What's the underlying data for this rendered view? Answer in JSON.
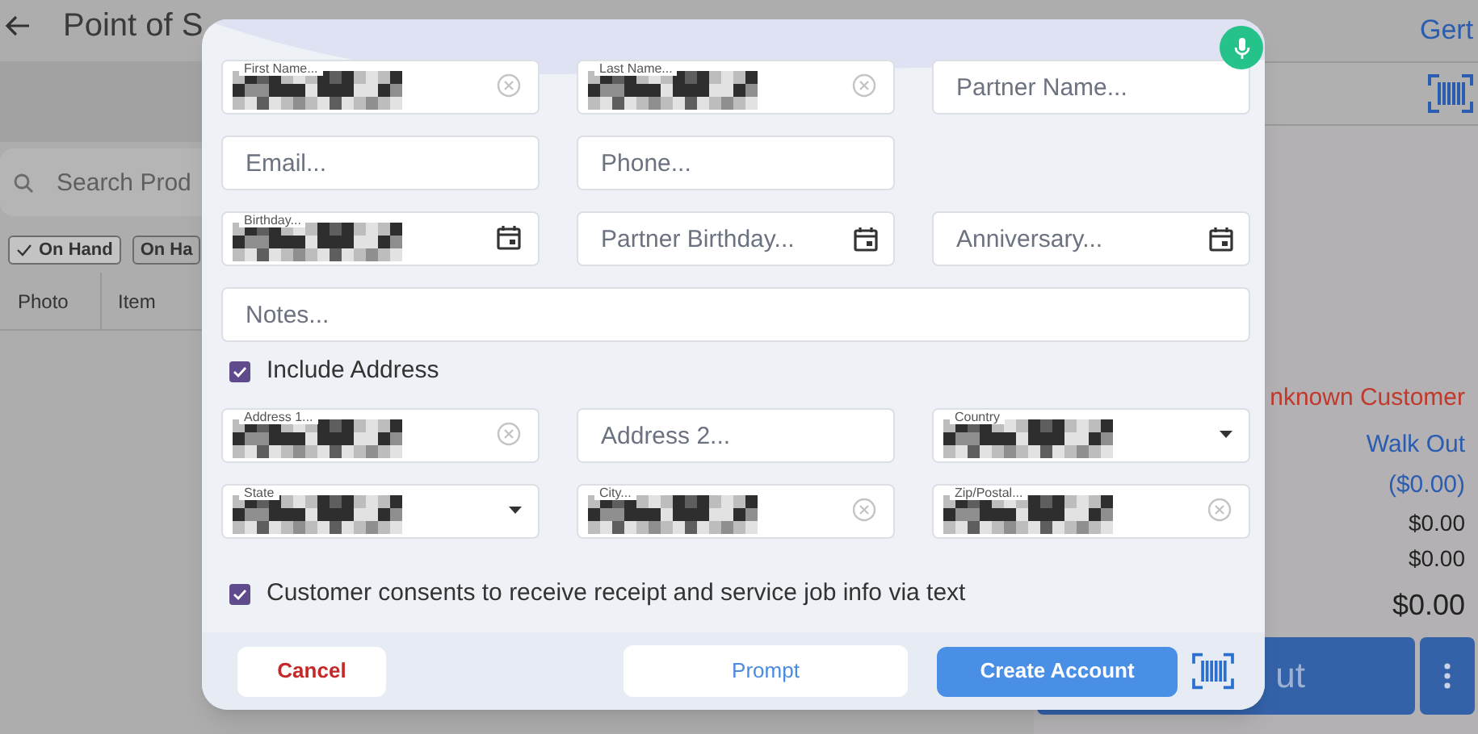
{
  "header": {
    "title": "Point of S",
    "user": "Gert"
  },
  "search": {
    "placeholder": "Search Prod"
  },
  "filters": [
    {
      "label": "On Hand",
      "selected": true
    },
    {
      "label": "On Ha",
      "selected": false
    }
  ],
  "table": {
    "columns": [
      "Photo",
      "Item"
    ]
  },
  "customer": {
    "name": "nknown Customer",
    "link": "Walk Out"
  },
  "totals": [
    {
      "kind": "credit",
      "text": "($0.00)"
    },
    {
      "kind": "line",
      "text": "$0.00"
    },
    {
      "kind": "line",
      "text": "$0.00"
    },
    {
      "kind": "total",
      "text": "$0.00"
    }
  ],
  "checkout": {
    "label": "ut"
  },
  "dialog": {
    "fields": [
      {
        "label": "First Name...",
        "kind": "text",
        "clear": true
      },
      {
        "label": "Last Name...",
        "kind": "text",
        "clear": true
      },
      {
        "placeholder": "Partner Name...",
        "kind": "text"
      },
      {
        "placeholder": "Email...",
        "kind": "text"
      },
      {
        "placeholder": "Phone...",
        "kind": "text"
      },
      {
        "kind": "blank"
      },
      {
        "label": "Birthday...",
        "kind": "date"
      },
      {
        "placeholder": "Partner Birthday...",
        "kind": "date"
      },
      {
        "placeholder": "Anniversary...",
        "kind": "date"
      },
      {
        "placeholder": "Notes...",
        "kind": "notes"
      }
    ],
    "include_address": {
      "label": "Include Address",
      "checked": true
    },
    "address_fields": [
      {
        "label": "Address 1...",
        "kind": "text",
        "clear": true
      },
      {
        "placeholder": "Address 2...",
        "kind": "text"
      },
      {
        "label": "Country",
        "kind": "select"
      },
      {
        "label": "State",
        "kind": "select"
      },
      {
        "label": "City...",
        "kind": "text",
        "clear": true
      },
      {
        "label": "Zip/Postal...",
        "kind": "text",
        "clear": true
      }
    ],
    "consent": {
      "label": "Customer consents to receive receipt and service job info via text",
      "checked": true
    },
    "buttons": [
      {
        "label": "Cancel",
        "kind": "cancel"
      },
      {
        "label": "Prompt",
        "kind": "secondary"
      },
      {
        "label": "Create Account",
        "kind": "primary"
      }
    ]
  }
}
